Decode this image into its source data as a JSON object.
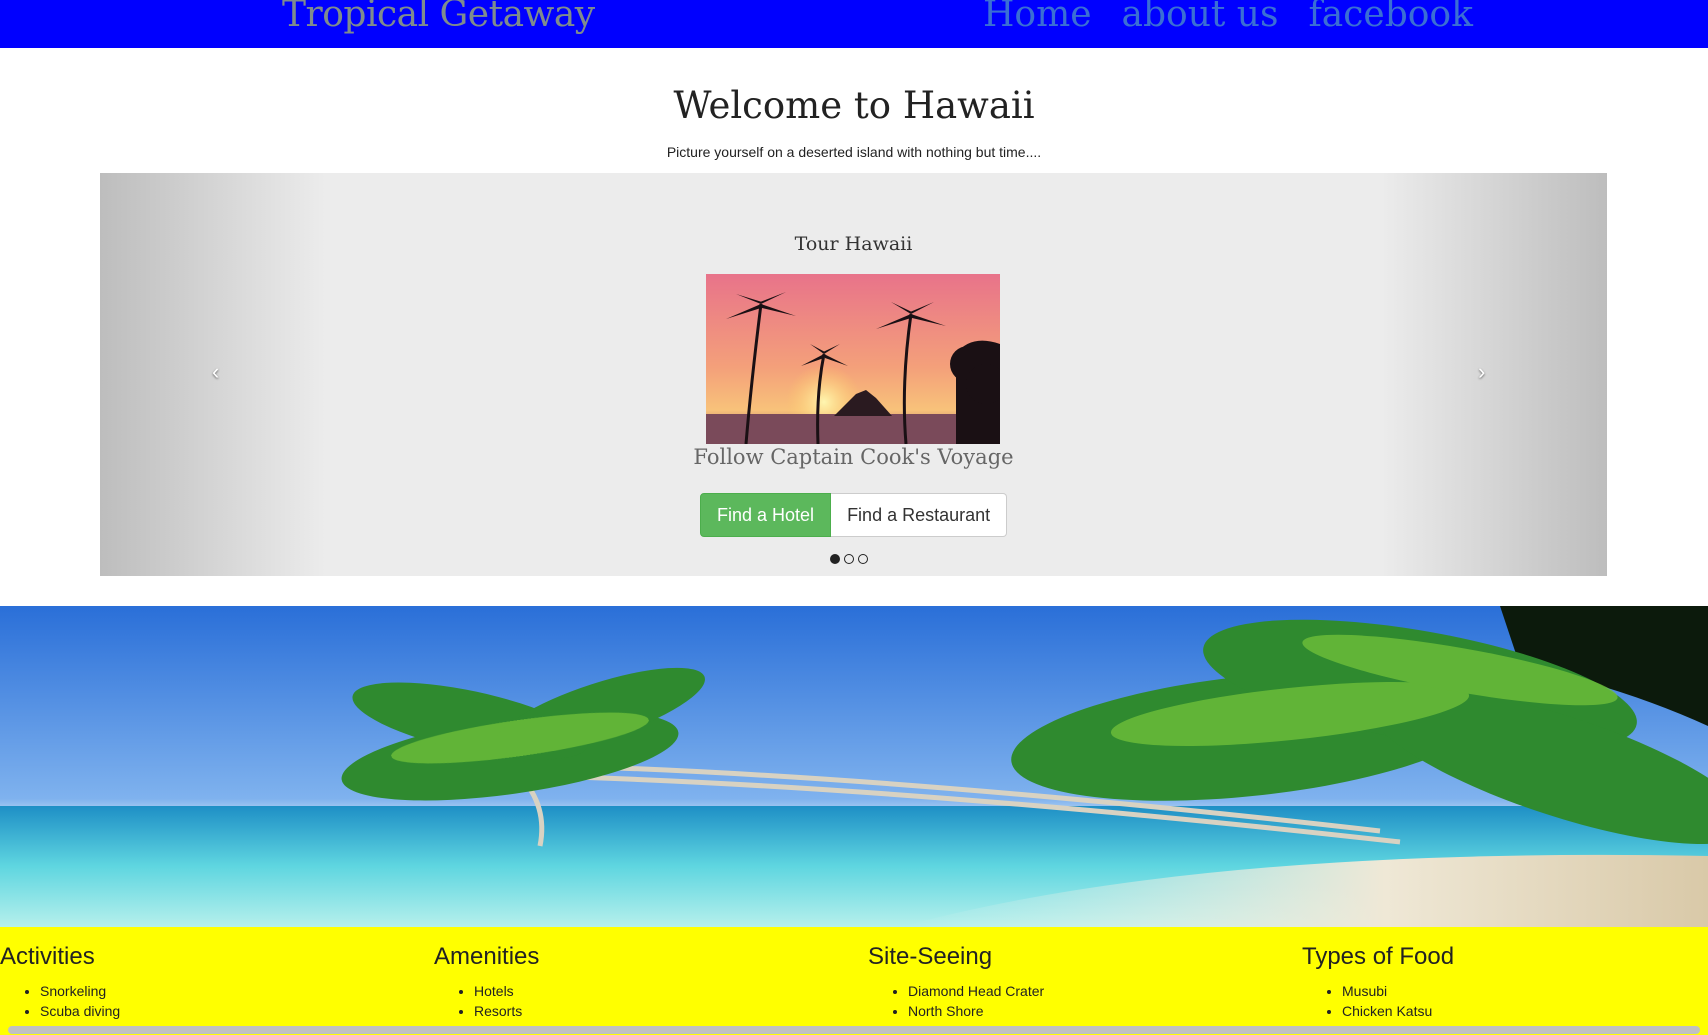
{
  "nav": {
    "brand": "Tropical Getaway",
    "links": [
      "Home",
      "about us",
      "facebook"
    ]
  },
  "main": {
    "title": "Welcome to Hawaii",
    "tagline": "Picture yourself on a deserted island with nothing but time...."
  },
  "carousel": {
    "title": "Tour Hawaii",
    "caption": "Follow Captain Cook's Voyage",
    "buttons": [
      "Find a Hotel",
      "Find a Restaurant"
    ],
    "prev_icon": "‹",
    "next_icon": "›",
    "indicators_total": 3,
    "active_indicator": 1
  },
  "footer": {
    "columns": [
      {
        "heading": "Activities",
        "items": [
          "Snorkeling",
          "Scuba diving"
        ]
      },
      {
        "heading": "Amenities",
        "items": [
          "Hotels",
          "Resorts"
        ]
      },
      {
        "heading": "Site-Seeing",
        "items": [
          "Diamond Head Crater",
          "North Shore"
        ]
      },
      {
        "heading": "Types of Food",
        "items": [
          "Musubi",
          "Chicken Katsu"
        ]
      }
    ]
  },
  "colors": {
    "navbar": "#0000ff",
    "footer": "#ffff00",
    "hotel_button": "#5cb85c"
  }
}
